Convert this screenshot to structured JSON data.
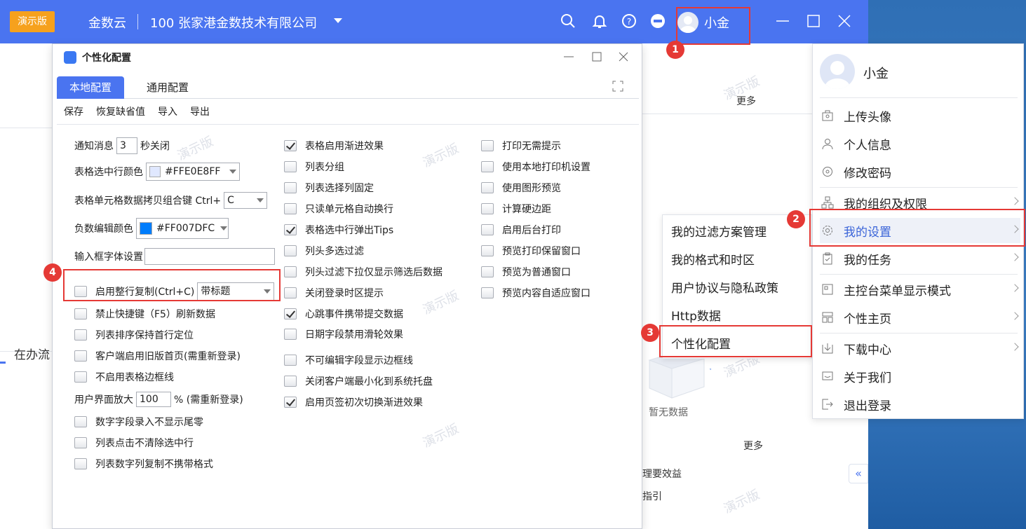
{
  "topbar": {
    "demo_badge": "演示版",
    "app_name": "金数云",
    "company": "100  张家港金数技术有限公司",
    "user_name": "小金"
  },
  "background": {
    "more1": "更多",
    "more2": "更多",
    "tab_label": "在办流",
    "empty_text": "暂无数据",
    "line1": "理要效益",
    "line2": "指引",
    "watermark": "演示版"
  },
  "dialog": {
    "title": "个性化配置",
    "tabs": [
      "本地配置",
      "通用配置"
    ],
    "toolbar": [
      "保存",
      "恢复缺省值",
      "导入",
      "导出"
    ],
    "col1": {
      "notify_prefix": "通知消息",
      "notify_value": "3",
      "notify_suffix": "秒关闭",
      "row_color_label": "表格选中行颜色",
      "row_color_value": "#FFE0E8FF",
      "copy_key_label": "表格单元格数据拷贝组合键 Ctrl+",
      "copy_key_value": "C",
      "neg_color_label": "负数编辑颜色",
      "neg_color_value": "#FF007DFC",
      "font_label": "输入框字体设置",
      "whole_row_copy_label": "启用整行复制(Ctrl+C)",
      "whole_row_copy_value": "带标题",
      "disable_f5": "禁止快捷键（F5）刷新数据",
      "sort_keep_first": "列表排序保持首行定位",
      "old_home": "客户端启用旧版首页(需重新登录)",
      "no_table_border": "不启用表格边框线",
      "zoom_prefix": "用户界面放大",
      "zoom_value": "100",
      "zoom_suffix": "% (需重新登录)",
      "no_trailing_zero": "数字字段录入不显示尾零",
      "click_keep_select": "列表点击不清除选中行",
      "copy_no_format": "列表数字列复制不携带格式"
    },
    "col2": [
      {
        "label": "表格启用渐进效果",
        "checked": true
      },
      {
        "label": "列表分组",
        "checked": false
      },
      {
        "label": "列表选择列固定",
        "checked": false
      },
      {
        "label": "只读单元格自动换行",
        "checked": false
      },
      {
        "label": "表格选中行弹出Tips",
        "checked": true
      },
      {
        "label": "列头多选过滤",
        "checked": false
      },
      {
        "label": "列头过滤下拉仅显示筛选后数据",
        "checked": false
      },
      {
        "label": "关闭登录时区提示",
        "checked": false
      },
      {
        "label": "心跳事件携带提交数据",
        "checked": true
      },
      {
        "label": "日期字段禁用滑轮效果",
        "checked": false
      },
      {
        "label": "不可编辑字段显示边框线",
        "checked": false
      },
      {
        "label": "关闭客户端最小化到系统托盘",
        "checked": false
      },
      {
        "label": "启用页签初次切换渐进效果",
        "checked": true
      }
    ],
    "col3": [
      {
        "label": "打印无需提示",
        "checked": false
      },
      {
        "label": "使用本地打印机设置",
        "checked": false
      },
      {
        "label": "使用图形预览",
        "checked": false
      },
      {
        "label": "计算硬边距",
        "checked": false
      },
      {
        "label": "启用后台打印",
        "checked": false
      },
      {
        "label": "预览打印保留窗口",
        "checked": false
      },
      {
        "label": "预览为普通窗口",
        "checked": false
      },
      {
        "label": "预览内容自适应窗口",
        "checked": false
      }
    ]
  },
  "submenu": [
    "我的过滤方案管理",
    "我的格式和时区",
    "用户协议与隐私政策",
    "Http数据",
    "个性化配置"
  ],
  "user_menu": {
    "name": "小金",
    "items": [
      "上传头像",
      "个人信息",
      "修改密码",
      "我的组织及权限",
      "我的设置",
      "我的任务",
      "主控台菜单显示模式",
      "个性主页",
      "下载中心",
      "关于我们",
      "退出登录"
    ]
  },
  "callouts": [
    "1",
    "2",
    "3",
    "4"
  ],
  "colors": {
    "accent": "#4a74f0",
    "callout": "#e53935",
    "row_color": "#FFE0E8FF",
    "neg_color": "#007DFC"
  }
}
